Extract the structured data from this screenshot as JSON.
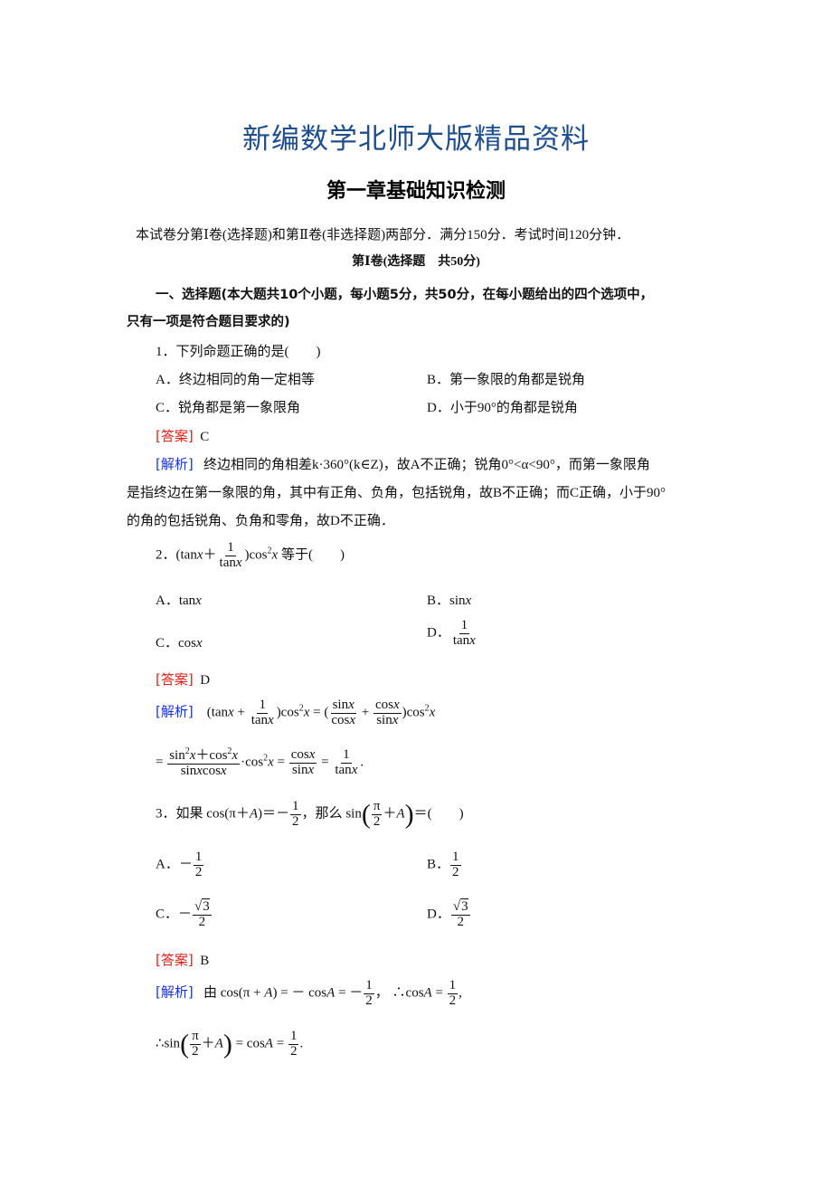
{
  "header": {
    "brand_title": "新编数学北师大版精品资料",
    "chapter_title": "第一章基础知识检测"
  },
  "intro": "本试卷分第Ⅰ卷(选择题)和第Ⅱ卷(非选择题)两部分．满分150分．考试时间120分钟．",
  "volume_heading": "第Ⅰ卷(选择题　共50分)",
  "section": {
    "line1": "一、选择题(本大题共10个小题，每小题5分，共50分，在每小题给出的四个选项中，",
    "line2": "只有一项是符合题目要求的)"
  },
  "labels": {
    "answer": "[答案]",
    "explanation": "[解析]"
  },
  "colors": {
    "brand": "#1f4e8c",
    "answer_label": "#e0201b",
    "explanation_label": "#1d35d8"
  },
  "questions": [
    {
      "number": "1．",
      "stem": "下列命题正确的是(　　)",
      "options": {
        "A": "A．终边相同的角一定相等",
        "B": "B．第一象限的角都是锐角",
        "C": "C．锐角都是第一象限角",
        "D": "D．小于90°的角都是锐角"
      },
      "answer": "C",
      "explanation": [
        "终边相同的角相差k·360°(k∈Z)，故A不正确；锐角0°<α<90°，而第一象限角",
        "是指终边在第一象限的角，其中有正角、负角，包括锐角，故B不正确；而C正确，小于90°",
        "的角的包括锐角、负角和零角，故D不正确．"
      ]
    },
    {
      "number": "2．",
      "stem_suffix": "等于(　　)",
      "options": {
        "A": "tanx",
        "B": "sinx",
        "C": "cosx",
        "D": "1/tanx"
      },
      "answer": "D"
    },
    {
      "number": "3．",
      "stem_prefix": "如果",
      "stem_mid": "那么",
      "stem_suffix": "＝(　　)",
      "options": {
        "A": "-1/2",
        "B": "1/2",
        "C": "-√3/2",
        "D": "√3/2"
      },
      "answer": "B",
      "explanation_prefix": "由"
    }
  ]
}
